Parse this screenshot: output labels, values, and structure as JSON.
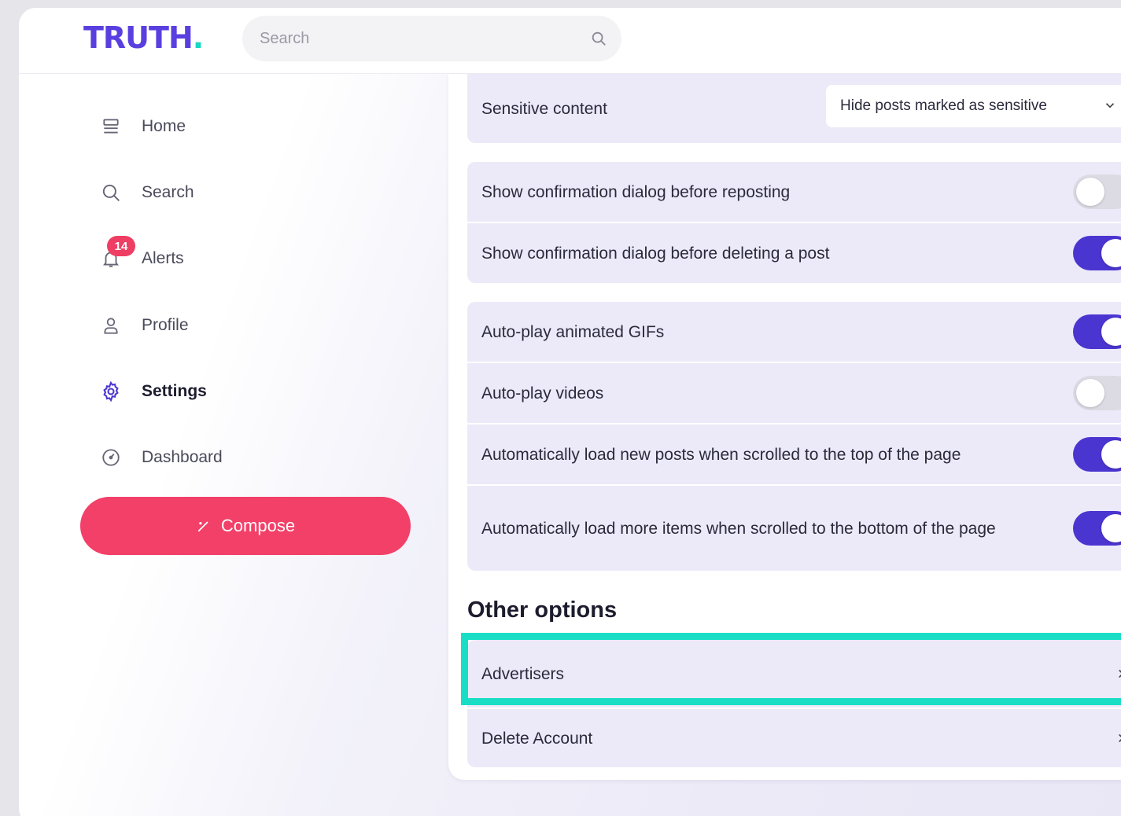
{
  "header": {
    "logo_text": "TRUTH",
    "logo_dot": ".",
    "search_placeholder": "Search"
  },
  "sidebar": {
    "items": [
      {
        "label": "Home",
        "icon": "home-icon"
      },
      {
        "label": "Search",
        "icon": "search-icon"
      },
      {
        "label": "Alerts",
        "icon": "bell-icon",
        "badge": "14"
      },
      {
        "label": "Profile",
        "icon": "user-icon"
      },
      {
        "label": "Settings",
        "icon": "gear-icon",
        "active": true
      },
      {
        "label": "Dashboard",
        "icon": "dashboard-icon"
      }
    ],
    "compose_label": "Compose"
  },
  "settings": {
    "sensitive": {
      "label": "Sensitive content",
      "value": "Hide posts marked as sensitive"
    },
    "confirm_group": [
      {
        "label": "Show confirmation dialog before reposting",
        "on": false
      },
      {
        "label": "Show confirmation dialog before deleting a post",
        "on": true
      }
    ],
    "autoplay_group": [
      {
        "label": "Auto-play animated GIFs",
        "on": true
      },
      {
        "label": "Auto-play videos",
        "on": false
      },
      {
        "label": "Automatically load new posts when scrolled to the top of the page",
        "on": true
      },
      {
        "label": "Automatically load more items when scrolled to the bottom of the page",
        "on": true
      }
    ],
    "other_title": "Other options",
    "other_options": [
      {
        "label": "Advertisers"
      },
      {
        "label": "Delete Account"
      }
    ]
  },
  "colors": {
    "accent": "#4b35d1",
    "brand": "#5a3fe0",
    "compose": "#f24069",
    "highlight": "#19dec5",
    "badge": "#ef3e64"
  }
}
